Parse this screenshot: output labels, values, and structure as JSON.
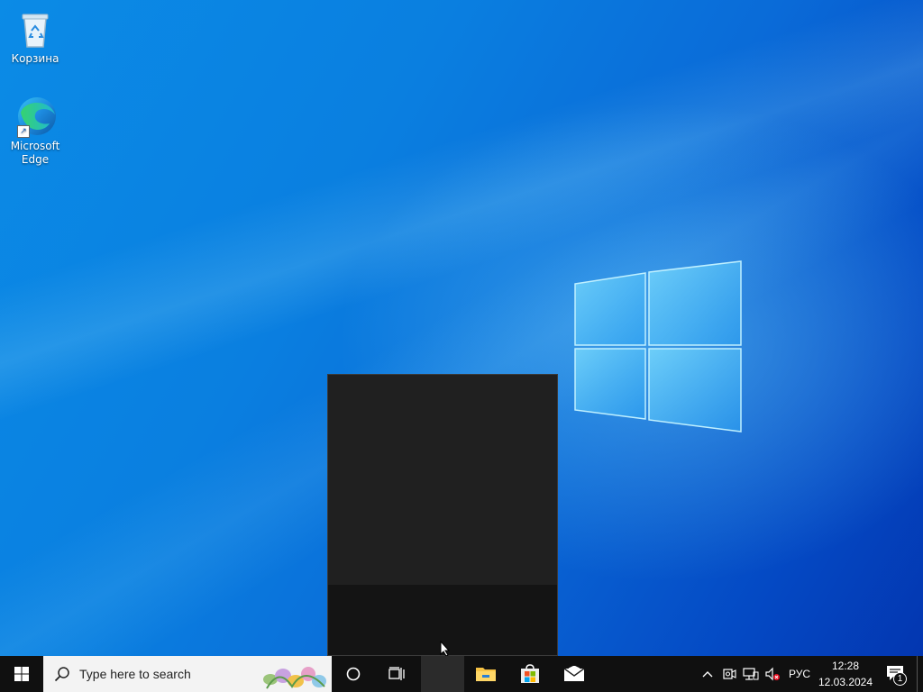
{
  "desktop": {
    "icons": [
      {
        "label": "Корзина",
        "icon": "recycle-bin-icon"
      },
      {
        "label": "Microsoft Edge",
        "label_line1": "Microsoft",
        "label_line2": "Edge",
        "icon": "edge-icon"
      }
    ],
    "wallpaper": "windows-10-hero",
    "colors": {
      "accent": "#0a7fe0",
      "deep": "#0336b0"
    }
  },
  "popup": {
    "background": "#202020"
  },
  "taskbar": {
    "start_icon": "windows-start-icon",
    "search_placeholder": "Type here to search",
    "cortana_icon": "cortana-circle-icon",
    "task_view_icon": "task-view-icon",
    "pinned": [
      {
        "name": "file-explorer",
        "icon": "folder-icon"
      },
      {
        "name": "microsoft-store",
        "icon": "store-icon"
      },
      {
        "name": "mail",
        "icon": "mail-icon"
      }
    ],
    "tray": {
      "chevron_icon": "chevron-up-icon",
      "language": "РУС",
      "time": "12:28",
      "date": "12.03.2024",
      "notifications_count": "1"
    }
  }
}
